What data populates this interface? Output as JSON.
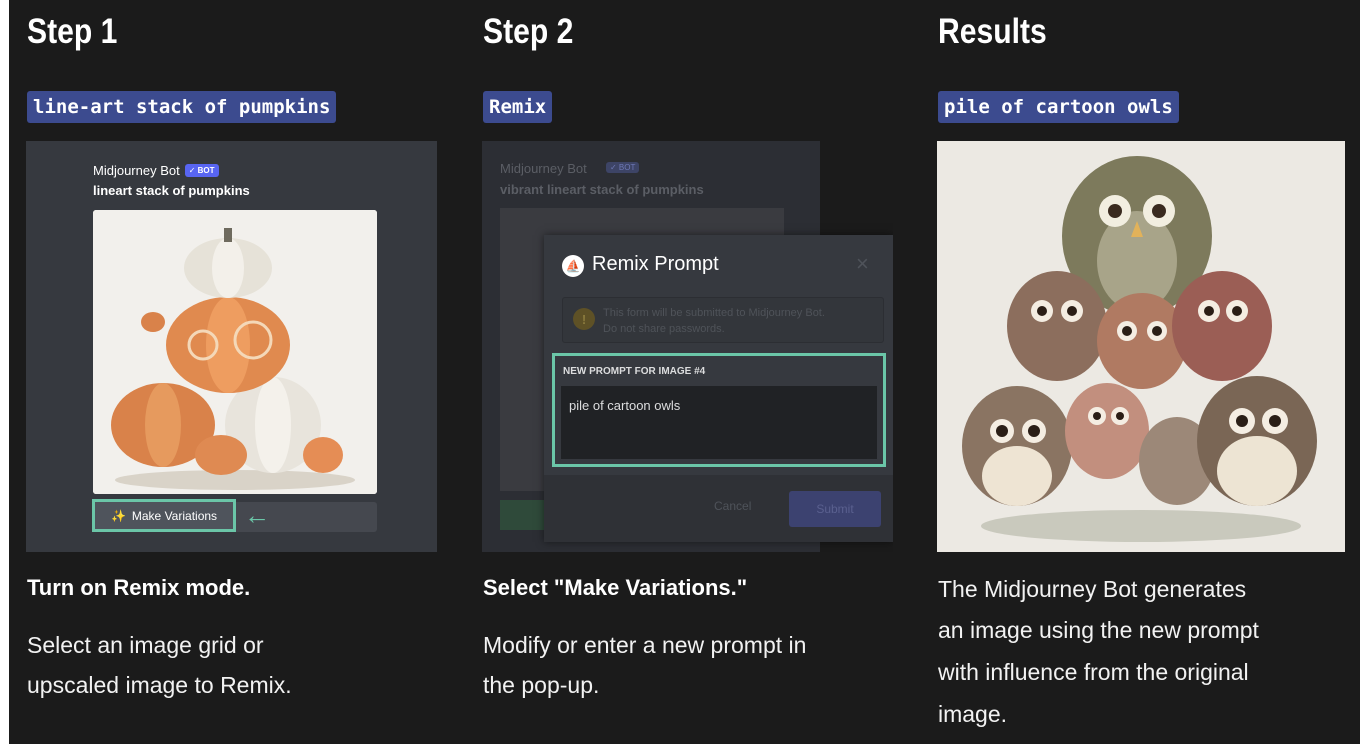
{
  "steps": [
    {
      "title": "Step 1",
      "prompt_chip": "line-art stack of pumpkins",
      "caption_title": "Turn on Remix mode.",
      "caption_lines": [
        "Select an image grid or",
        "upscaled image to Remix."
      ]
    },
    {
      "title": "Step 2",
      "prompt_chip": "Remix",
      "caption_title": "Select \"Make Variations.\"",
      "caption_lines": [
        "Modify or enter a new prompt in",
        "the pop-up."
      ]
    },
    {
      "title": "Results",
      "prompt_chip": "pile of cartoon owls",
      "caption_lines": [
        "The Midjourney Bot generates",
        "an image using the new prompt",
        "with influence from the original",
        "image."
      ]
    }
  ],
  "step1_panel": {
    "bot_name": "Midjourney Bot",
    "bot_badge": "✓ BOT",
    "message": "lineart stack of pumpkins",
    "make_variations_label": "Make Variations",
    "arrow": "←"
  },
  "step2_panel": {
    "bg_bot_name": "Midjourney Bot",
    "bg_bot_badge": "✓ BOT",
    "bg_message": "vibrant lineart stack of pumpkins",
    "modal_title": "Remix Prompt",
    "notice_line1": "This form will be submitted to Midjourney Bot.",
    "notice_line2": "Do not share passwords.",
    "prompt_label": "NEW PROMPT FOR IMAGE #4",
    "prompt_value": "pile of cartoon owls",
    "cancel_label": "Cancel",
    "submit_label": "Submit",
    "close_glyph": "×"
  },
  "colors": {
    "background": "#1b1b1b",
    "chip": "#3c4b8f",
    "highlight": "#6bc6a8",
    "discord_panel": "#36393f"
  }
}
